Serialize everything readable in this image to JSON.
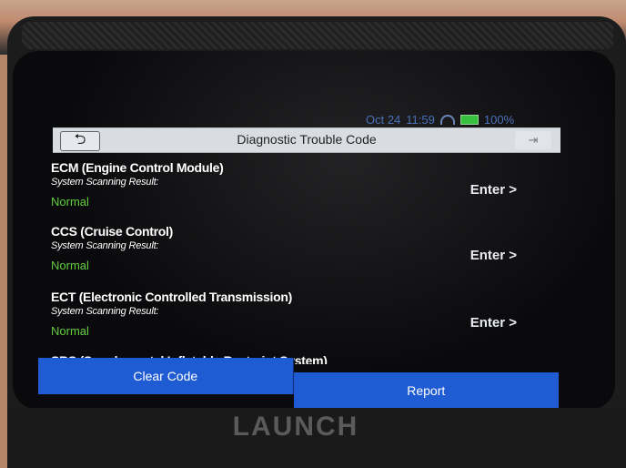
{
  "device": {
    "brand": "LAUNCH"
  },
  "status_bar": {
    "date": "Oct 24",
    "time": "11:59",
    "battery": "100%"
  },
  "header": {
    "back_icon": "back-arrow-icon",
    "title": "Diagnostic Trouble Code",
    "exit_icon": "exit-icon"
  },
  "systems": [
    {
      "name": "ECM (Engine Control Module)",
      "scan_label": "System Scanning Result:",
      "status": "Normal",
      "enter": "Enter >"
    },
    {
      "name": "CCS (Cruise Control)",
      "scan_label": "System Scanning Result:",
      "status": "Normal",
      "enter": "Enter >"
    },
    {
      "name": "ECT (Electronic Controlled Transmission)",
      "scan_label": "System Scanning Result:",
      "status": "Normal",
      "enter": "Enter >"
    },
    {
      "name": "SRS (Supplemental Inflatable Restraint System)"
    }
  ],
  "actions": {
    "clear_code": "Clear Code",
    "report": "Report"
  },
  "colors": {
    "status_normal": "#5fcf3d",
    "button_blue": "#1f5bd2",
    "title_bar": "#d9dde2"
  }
}
